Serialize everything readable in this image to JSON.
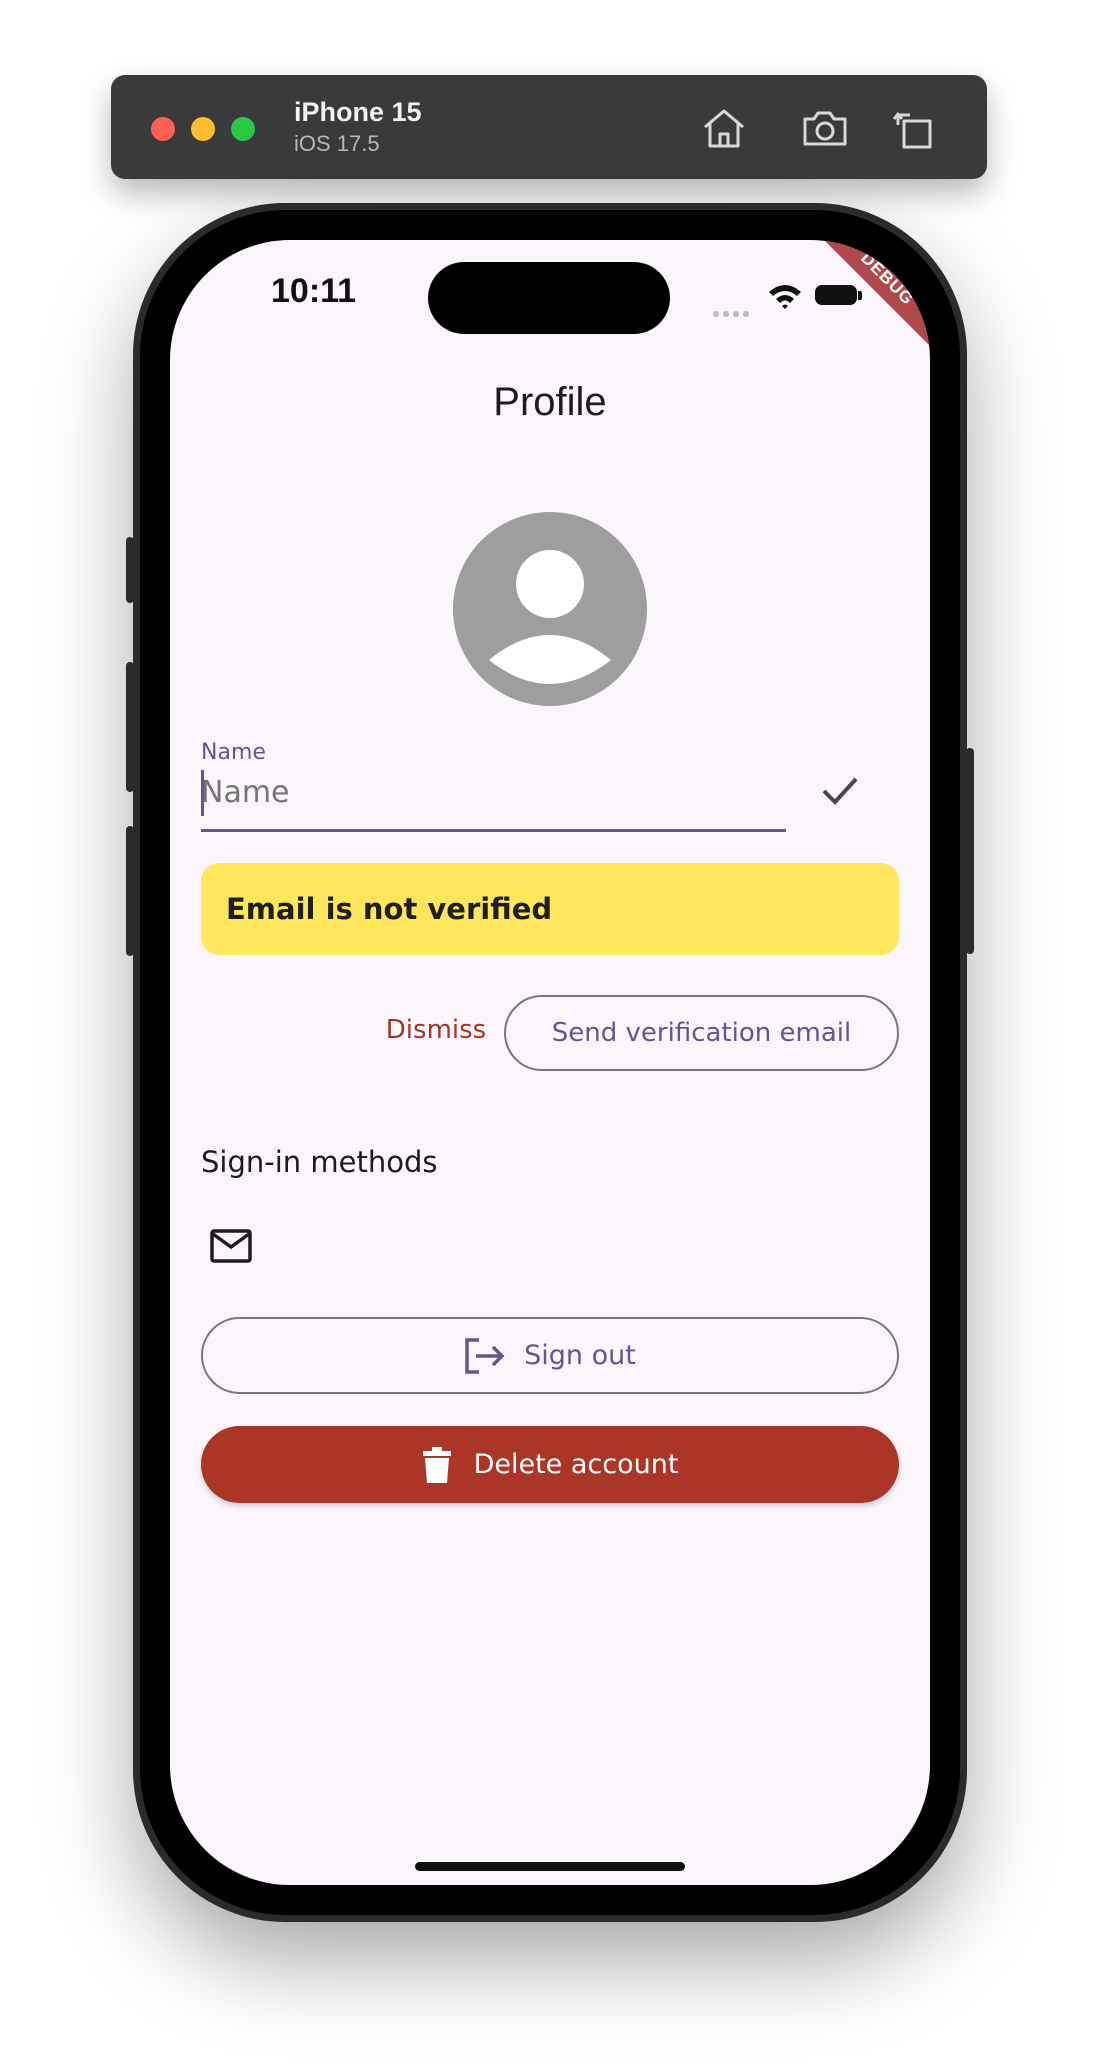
{
  "simulator": {
    "device_name": "iPhone 15",
    "os_version": "iOS 17.5",
    "buttons": [
      "home-icon",
      "screenshot-icon",
      "rotate-icon"
    ]
  },
  "status_bar": {
    "time": "10:11",
    "debug_banner": "DEBUG"
  },
  "page": {
    "title": "Profile"
  },
  "name_field": {
    "label": "Name",
    "placeholder": "Name",
    "value": ""
  },
  "verification_banner": {
    "text": "Email is not verified",
    "background": "#ffe65c"
  },
  "actions": {
    "dismiss_label": "Dismiss",
    "send_verification_label": "Send verification email"
  },
  "sign_in_methods": {
    "title": "Sign-in methods",
    "methods": [
      "mail-icon"
    ]
  },
  "buttons": {
    "sign_out_label": "Sign out",
    "delete_account_label": "Delete account"
  },
  "colors": {
    "primary": "#65558f",
    "error": "#ab3527",
    "warning": "#ffe65c",
    "background": "#fbf6fc"
  }
}
